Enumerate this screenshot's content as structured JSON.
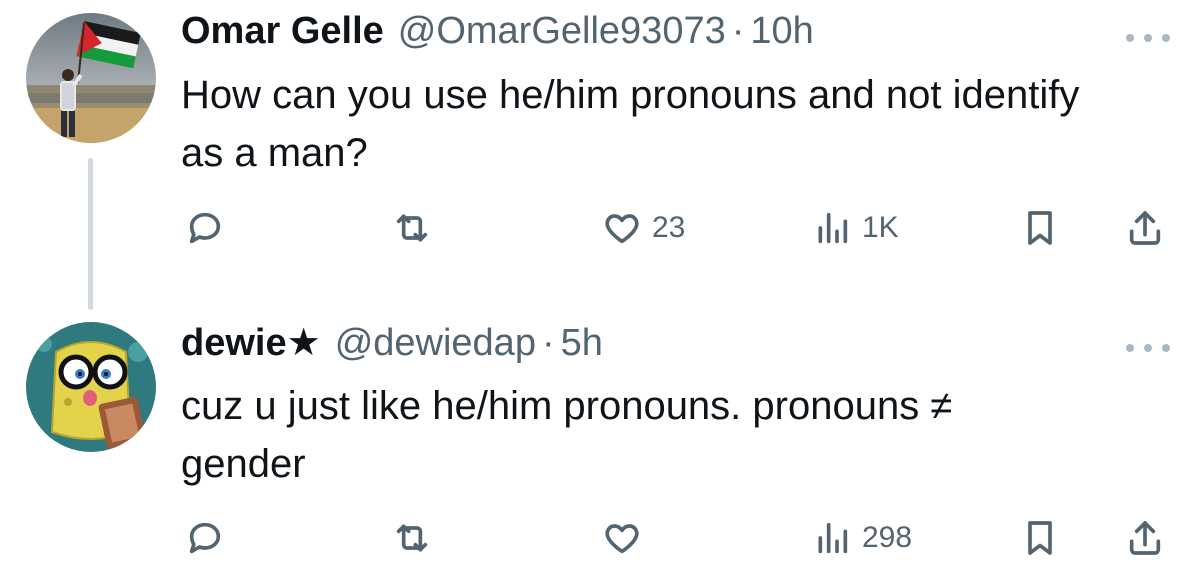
{
  "tweets": [
    {
      "author": {
        "name": "Omar Gelle",
        "handle": "@OmarGelle93073",
        "badge": ""
      },
      "separator": "·",
      "time": "10h",
      "text": "How can you use he/him pronouns and not identify as a man?",
      "actions": {
        "reply_count": "",
        "retweet_count": "",
        "like_count": "23",
        "views_count": "1K"
      },
      "avatar_icon": "flag-person-avatar"
    },
    {
      "author": {
        "name": "dewie",
        "handle": "@dewiedap",
        "badge": "★"
      },
      "separator": "·",
      "time": "5h",
      "text": "cuz u just like he/him pronouns. pronouns ≠ gender",
      "actions": {
        "reply_count": "",
        "retweet_count": "",
        "like_count": "",
        "views_count": "298"
      },
      "avatar_icon": "cartoon-character-avatar"
    }
  ],
  "colors": {
    "text": "#0f1419",
    "secondary": "#536471",
    "thread_line": "#cfd9de"
  }
}
